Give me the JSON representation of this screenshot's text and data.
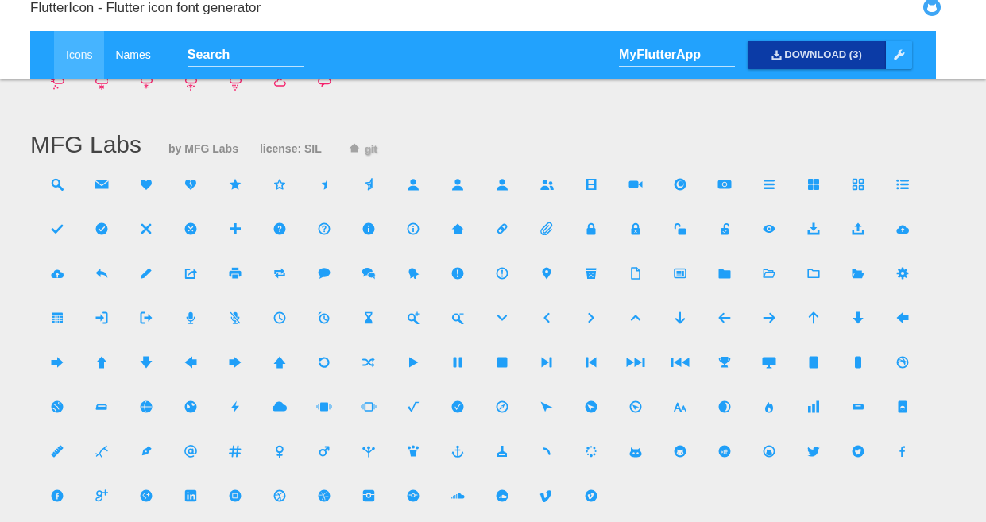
{
  "page_title": "FlutterIcon - Flutter icon font generator",
  "toolbar": {
    "tabs": [
      {
        "label": "Icons",
        "selected": true
      },
      {
        "label": "Names",
        "selected": false
      }
    ],
    "search": {
      "placeholder": "Search"
    },
    "app_name": {
      "value": "MyFlutterApp"
    },
    "download_button": {
      "label": "DOWNLOAD (3)"
    }
  },
  "section": {
    "title": "MFG Labs",
    "author": "by MFG Labs",
    "license": "license: SIL",
    "link": "git"
  }
}
